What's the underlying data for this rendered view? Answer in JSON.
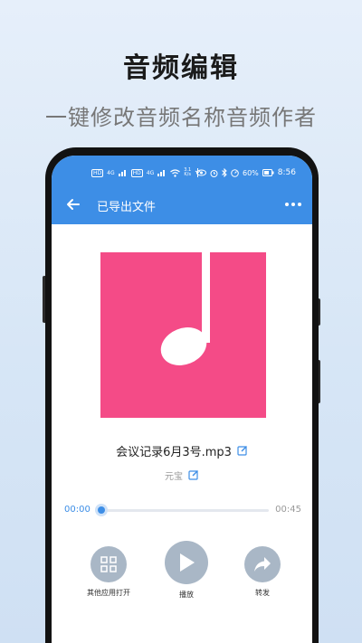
{
  "promo": {
    "title": "音频编辑",
    "subtitle": "一键修改音频名称音频作者"
  },
  "status_bar": {
    "left_indicators": [
      "HD",
      "4G",
      "HD",
      "4G",
      "wifi-icon",
      "3.1 K/s",
      "usb-icon"
    ],
    "speed_value": "3.1",
    "speed_unit": "K/s",
    "battery": "60%",
    "time": "8:56"
  },
  "toolbar": {
    "title": "已导出文件"
  },
  "track": {
    "file_name": "会议记录6月3号.mp3",
    "author": "元宝"
  },
  "player": {
    "current_time": "00:00",
    "total_time": "00:45",
    "progress": 0.0
  },
  "actions": [
    {
      "label": "其他应用打开",
      "icon": "open-with-icon"
    },
    {
      "label": "播放",
      "icon": "play-icon"
    },
    {
      "label": "转发",
      "icon": "share-icon"
    }
  ],
  "colors": {
    "accent": "#3d8ee6",
    "cover": "#f44b87",
    "action_circle": "#a9b7c6"
  }
}
